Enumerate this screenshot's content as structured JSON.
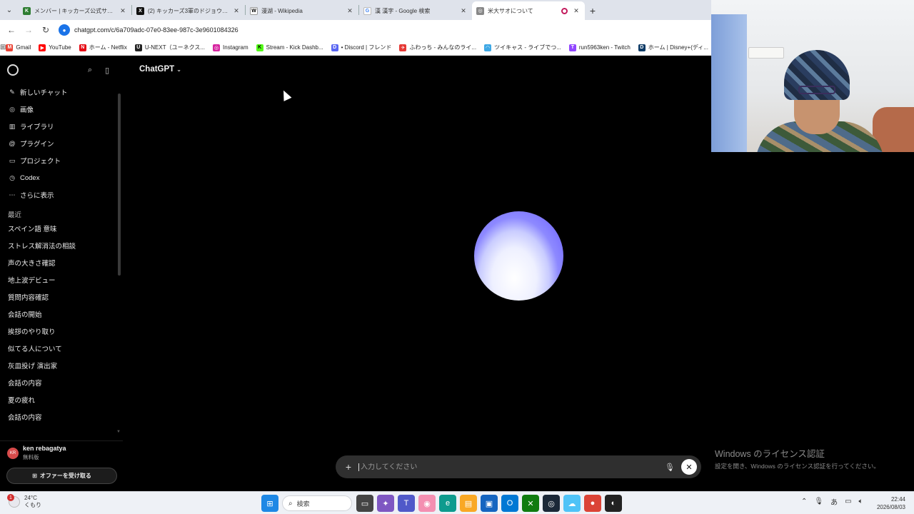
{
  "browser": {
    "tabs": [
      {
        "title": "メンバー | キッカーズ公式サイト",
        "fav_color": "#2e7d32",
        "fav_glyph": "K",
        "active": false
      },
      {
        "title": "(2) キッカーズ3軍のドジョウ（@run",
        "fav_color": "#111111",
        "fav_glyph": "X",
        "active": false
      },
      {
        "title": "漫湖 - Wikipedia",
        "fav_color": "#ffffff",
        "fav_glyph": "W",
        "active": false
      },
      {
        "title": "漢 漢字 - Google 検索",
        "fav_color": "#ffffff",
        "fav_glyph": "G",
        "active": false
      },
      {
        "title": "米大サオについて",
        "fav_color": "#888888",
        "fav_glyph": "◎",
        "active": true
      }
    ],
    "url": "chatgpt.com/c/6a709adc-07e0-83ee-987c-3e9601084326",
    "bookmarks": [
      {
        "label": "Gmail",
        "color": "#ea4335",
        "glyph": "M"
      },
      {
        "label": "YouTube",
        "color": "#ff0000",
        "glyph": "▶"
      },
      {
        "label": "ホーム - Netflix",
        "color": "#e50914",
        "glyph": "N"
      },
      {
        "label": "U-NEXT（ユーネクス...",
        "color": "#222222",
        "glyph": "U"
      },
      {
        "label": "Instagram",
        "color": "#d6249f",
        "glyph": "◎"
      },
      {
        "label": "Stream - Kick Dashb...",
        "color": "#53fc18",
        "glyph": "K"
      },
      {
        "label": "• Discord | フレンド",
        "color": "#5865f2",
        "glyph": "D"
      },
      {
        "label": "ふわっち - みんなのライ...",
        "color": "#e53935",
        "glyph": "✈"
      },
      {
        "label": "ツイキャス - ライブでつ...",
        "color": "#3ea8e5",
        "glyph": "◠"
      },
      {
        "label": "run5963ken - Twitch",
        "color": "#9146ff",
        "glyph": "T"
      },
      {
        "label": "ホーム | Disney+(ディ...",
        "color": "#0d3b66",
        "glyph": "D"
      },
      {
        "label": "ニ",
        "color": "#222222",
        "glyph": "▪"
      }
    ]
  },
  "sidebar": {
    "nav": [
      {
        "label": "新しいチャット",
        "icon": "✎"
      },
      {
        "label": "画像",
        "icon": "◎"
      },
      {
        "label": "ライブラリ",
        "icon": "▥"
      },
      {
        "label": "プラグイン",
        "icon": "@"
      },
      {
        "label": "プロジェクト",
        "icon": "▭"
      },
      {
        "label": "Codex",
        "icon": "◷"
      },
      {
        "label": "さらに表示",
        "icon": "⋯"
      }
    ],
    "recent_heading": "最近",
    "chats": [
      "スペイン語 意味",
      "ストレス解消法の相談",
      "声の大きさ確認",
      "地上波デビュー",
      "質問内容確認",
      "会話の開始",
      "挨拶のやり取り",
      "似てる人について",
      "灰皿投げ 演出家",
      "会話の内容",
      "夏の疲れ",
      "会話の内容"
    ],
    "user": {
      "name": "ken rebagatya",
      "plan": "無料版",
      "initials": "KR"
    },
    "offer_button": "オファーを受け取る"
  },
  "main": {
    "model_label": "ChatGPT",
    "composer_placeholder": "入力してください"
  },
  "watermark": {
    "title": "Windows のライセンス認証",
    "subtitle": "設定を開き、Windows のライセンス認証を行ってください。"
  },
  "taskbar": {
    "weather_temp": "24°C",
    "weather_cond": "くもり",
    "notification_count": "1",
    "search_label": "検索",
    "ime_label": "あ",
    "time": "22:44",
    "date": "2026/08/03"
  }
}
